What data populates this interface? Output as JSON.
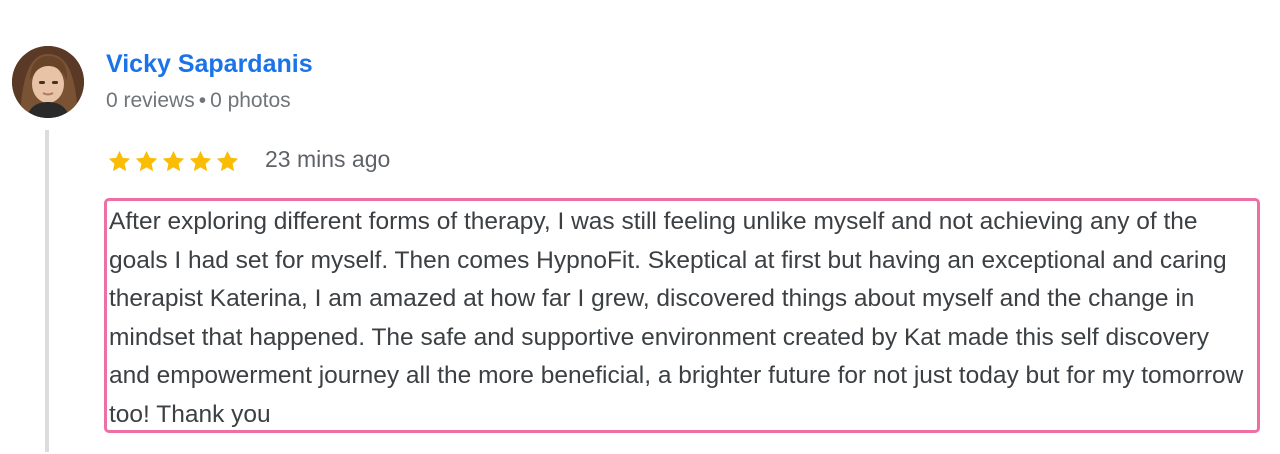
{
  "reviewer": {
    "name": "Vicky Sapardanis",
    "reviews": "0 reviews",
    "separator": "•",
    "photos": "0 photos",
    "avatar_icon": "user-photo"
  },
  "review": {
    "rating": 5,
    "rating_max": 5,
    "star_color": "#fbbc04",
    "time_ago": "23 mins ago",
    "text": "After exploring different forms of therapy, I was still feeling unlike myself and not achieving any of the goals I had set for myself. Then comes HypnoFit. Skeptical at first but having an exceptional and caring therapist Katerina, I am amazed at how far I grew, discovered things about myself and the change in mindset that happened. The safe and supportive environment created by Kat made this self discovery and empowerment journey all the more beneficial, a brighter future for not just today but for my tomorrow too! Thank you"
  },
  "colors": {
    "name_link": "#1a73e8",
    "meta_text": "#70757a",
    "highlight_border": "#ee6fa6",
    "thread_line": "#dadce0"
  }
}
